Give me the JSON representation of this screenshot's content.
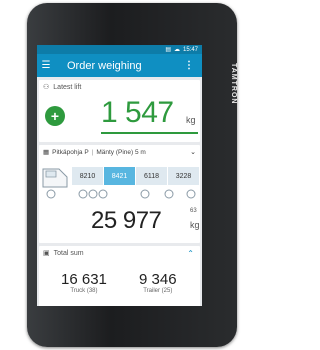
{
  "status_bar": {
    "time": "15:47"
  },
  "app_bar": {
    "title": "Order weighing"
  },
  "brand": "TAMTRON",
  "latest_lift": {
    "label": "Latest lift",
    "value": "1 547",
    "unit": "kg"
  },
  "load": {
    "product": "Pitkäpohja P",
    "variety": "Mänty (Pine) 5 m",
    "cells": [
      "8210",
      "8421",
      "6118",
      "3228"
    ],
    "active_cell": 1,
    "total": "25 977",
    "total_decimals": "63",
    "unit": "kg"
  },
  "total_sum": {
    "label": "Total sum",
    "truck_value": "16 631",
    "truck_label": "Truck (38)",
    "trailer_value": "9 346",
    "trailer_label": "Trailer (25)"
  },
  "icons": {
    "menu": "menu-icon",
    "more": "more-vert-icon",
    "latest": "lift-icon",
    "load": "document-icon",
    "expand_selector": "chevron-down-icon",
    "total": "calculator-icon",
    "collapse": "chevron-up-icon"
  },
  "colors": {
    "accent": "#0f8fc2",
    "positive": "#2e9a3e",
    "active_cell": "#58b6e0"
  }
}
